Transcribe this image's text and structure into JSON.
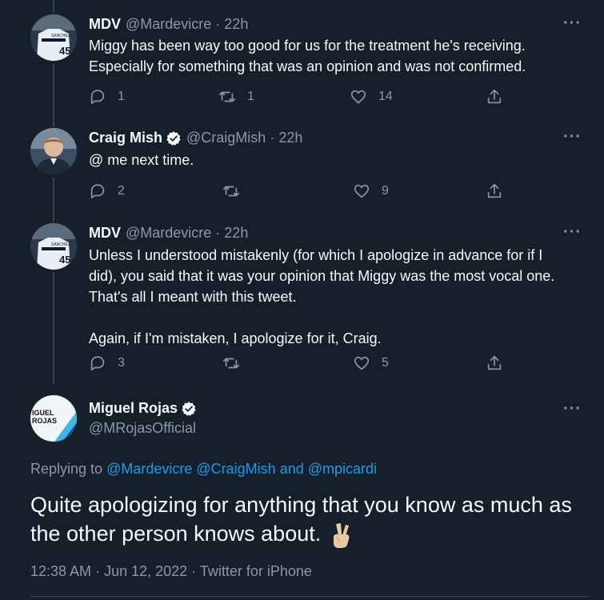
{
  "tweets": [
    {
      "name": "MDV",
      "handle": "@Mardevicre",
      "time": "22h",
      "text": "Miggy has been way too good for us for the treatment he's receiving.\nEspecially for something that was an opinion and was not confirmed.",
      "replies": "1",
      "retweets": "1",
      "likes": "14"
    },
    {
      "name": "Craig Mish",
      "handle": "@CraigMish",
      "time": "22h",
      "text": "@ me next time.",
      "replies": "2",
      "retweets": "",
      "likes": "9"
    },
    {
      "name": "MDV",
      "handle": "@Mardevicre",
      "time": "22h",
      "text": "Unless I understood mistakenly (for which I apologize in advance for if I\ndid), you said that it was your opinion that Miggy was the most vocal one.\nThat's all I meant with this tweet.\n\nAgain, if I'm mistaken, I apologize for it, Craig.",
      "replies": "3",
      "retweets": "",
      "likes": "5"
    }
  ],
  "main": {
    "name": "Miguel Rojas",
    "handle": "@MRojasOfficial",
    "avatar_text": "IGUEL\nROJAS",
    "replying_prefix": "Replying to",
    "mention1": "@Mardevicre",
    "mention2": "@CraigMish",
    "and": "and",
    "mention3": "@mpicardi",
    "text": "Quite apologizing for anything that you know as much as the other person knows about.",
    "time": "12:38 AM",
    "date": "Jun 12, 2022",
    "source": "Twitter for iPhone"
  },
  "more_label": "···",
  "jersey_number": "45",
  "jersey_name": "SANCHEZ",
  "colors": {
    "background": "#15202b",
    "text": "#f7f9f9",
    "muted": "#8b98a5",
    "link": "#1d9bf0",
    "divider": "#38444d"
  }
}
